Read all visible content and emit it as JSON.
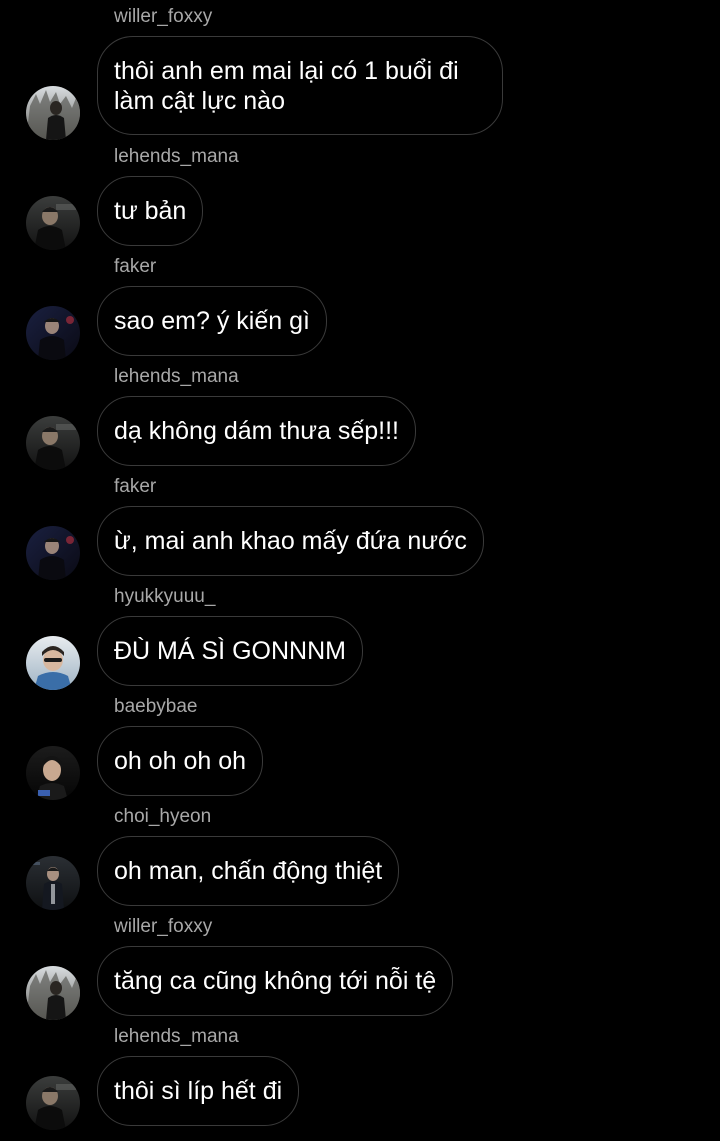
{
  "chat": {
    "messages": [
      {
        "username": "willer_foxxy",
        "text": "thôi anh em mai lại có 1 buổi đi làm cật lực nào",
        "avatar": "willer-avatar"
      },
      {
        "username": "lehends_mana",
        "text": "tư bản",
        "avatar": "lehends-avatar"
      },
      {
        "username": "faker",
        "text": "sao em? ý kiến gì",
        "avatar": "faker-avatar"
      },
      {
        "username": "lehends_mana",
        "text": "dạ không dám thưa sếp!!!",
        "avatar": "lehends-avatar"
      },
      {
        "username": "faker",
        "text": "ừ, mai anh khao mấy đứa nước",
        "avatar": "faker-avatar"
      },
      {
        "username": "hyukkyuuu_",
        "text": "ĐÙ MÁ SÌ GONNNM",
        "avatar": "hyukkyuuu-avatar"
      },
      {
        "username": "baebybae",
        "text": "oh oh oh oh",
        "avatar": "baebybae-avatar"
      },
      {
        "username": "choi_hyeon",
        "text": "oh man, chấn động thiệt",
        "avatar": "choi-hyeon-avatar"
      },
      {
        "username": "willer_foxxy",
        "text": "tăng ca cũng không tới nỗi tệ",
        "avatar": "willer-avatar"
      },
      {
        "username": "lehends_mana",
        "text": "thôi sì líp hết đi",
        "avatar": "lehends-avatar"
      }
    ]
  },
  "colors": {
    "background": "#000000",
    "bubble_border": "#3a3a3a",
    "username": "#a8a8a8",
    "message_text": "#ffffff"
  }
}
